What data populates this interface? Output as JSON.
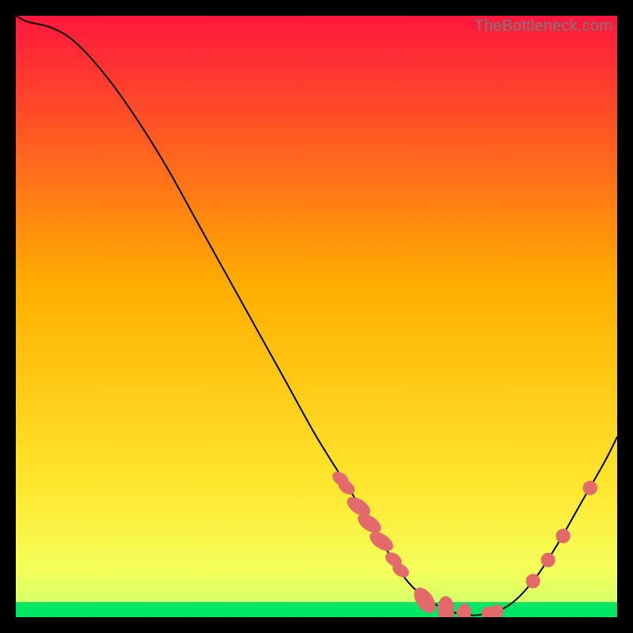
{
  "watermark": "TheBottleneck.com",
  "chart_data": {
    "type": "line",
    "title": "",
    "xlabel": "",
    "ylabel": "",
    "xlim": [
      0,
      100
    ],
    "ylim": [
      0,
      100
    ],
    "grid": false,
    "legend": false,
    "background_gradient": {
      "top_color": "#ff173e",
      "mid_color": "#ffd400",
      "bottom_color": "#00e765"
    },
    "green_band": {
      "top_y": 2.5,
      "bottom_y": 0,
      "color": "#00e765"
    },
    "series": [
      {
        "name": "bottleneck-curve",
        "x": [
          0,
          2,
          6,
          10,
          15,
          20,
          25,
          30,
          35,
          40,
          45,
          50,
          55,
          60,
          63,
          66,
          70,
          74,
          78,
          82,
          86,
          90,
          94,
          98,
          100
        ],
        "y": [
          100,
          99,
          98,
          95.5,
          90,
          83,
          75,
          66,
          57,
          48,
          39,
          30,
          22,
          14,
          9,
          5,
          2,
          0.5,
          0.5,
          2,
          6,
          12,
          19,
          26,
          30
        ],
        "stroke": "#000000",
        "stroke_width": 2
      }
    ],
    "markers": [
      {
        "type": "ellipse",
        "cx": 54.0,
        "cy": 23.0,
        "rx": 1.0,
        "ry": 1.5,
        "rot": -55,
        "fill": "#e26a6a"
      },
      {
        "type": "ellipse",
        "cx": 55.0,
        "cy": 21.6,
        "rx": 1.0,
        "ry": 1.5,
        "rot": -55,
        "fill": "#e26a6a"
      },
      {
        "type": "ellipse",
        "cx": 57.0,
        "cy": 18.4,
        "rx": 1.2,
        "ry": 2.2,
        "rot": -56,
        "fill": "#e26a6a"
      },
      {
        "type": "ellipse",
        "cx": 58.8,
        "cy": 15.6,
        "rx": 1.2,
        "ry": 2.2,
        "rot": -56,
        "fill": "#e26a6a"
      },
      {
        "type": "ellipse",
        "cx": 60.8,
        "cy": 12.6,
        "rx": 1.2,
        "ry": 2.2,
        "rot": -56,
        "fill": "#e26a6a"
      },
      {
        "type": "ellipse",
        "cx": 62.8,
        "cy": 9.6,
        "rx": 1.0,
        "ry": 1.5,
        "rot": -56,
        "fill": "#e26a6a"
      },
      {
        "type": "ellipse",
        "cx": 64.0,
        "cy": 7.8,
        "rx": 1.0,
        "ry": 1.5,
        "rot": -56,
        "fill": "#e26a6a"
      },
      {
        "type": "ellipse",
        "cx": 68.0,
        "cy": 2.8,
        "rx": 1.4,
        "ry": 2.4,
        "rot": -35,
        "fill": "#e26a6a"
      },
      {
        "type": "ellipse",
        "cx": 71.5,
        "cy": 1.3,
        "rx": 1.4,
        "ry": 2.2,
        "rot": 0,
        "fill": "#e26a6a"
      },
      {
        "type": "ellipse",
        "cx": 74.5,
        "cy": 0.7,
        "rx": 1.2,
        "ry": 1.6,
        "rot": 10,
        "fill": "#e26a6a"
      },
      {
        "type": "circle",
        "cx": 78.5,
        "cy": 0.7,
        "r": 1.1,
        "fill": "#e26a6a"
      },
      {
        "type": "circle",
        "cx": 80.0,
        "cy": 1.0,
        "r": 1.1,
        "fill": "#e26a6a"
      },
      {
        "type": "circle",
        "cx": 86.0,
        "cy": 6.0,
        "r": 1.2,
        "fill": "#e26a6a"
      },
      {
        "type": "circle",
        "cx": 88.5,
        "cy": 9.5,
        "r": 1.2,
        "fill": "#e26a6a"
      },
      {
        "type": "circle",
        "cx": 91.0,
        "cy": 13.5,
        "r": 1.2,
        "fill": "#e26a6a"
      },
      {
        "type": "circle",
        "cx": 95.5,
        "cy": 21.5,
        "r": 1.2,
        "fill": "#e26a6a"
      }
    ]
  }
}
